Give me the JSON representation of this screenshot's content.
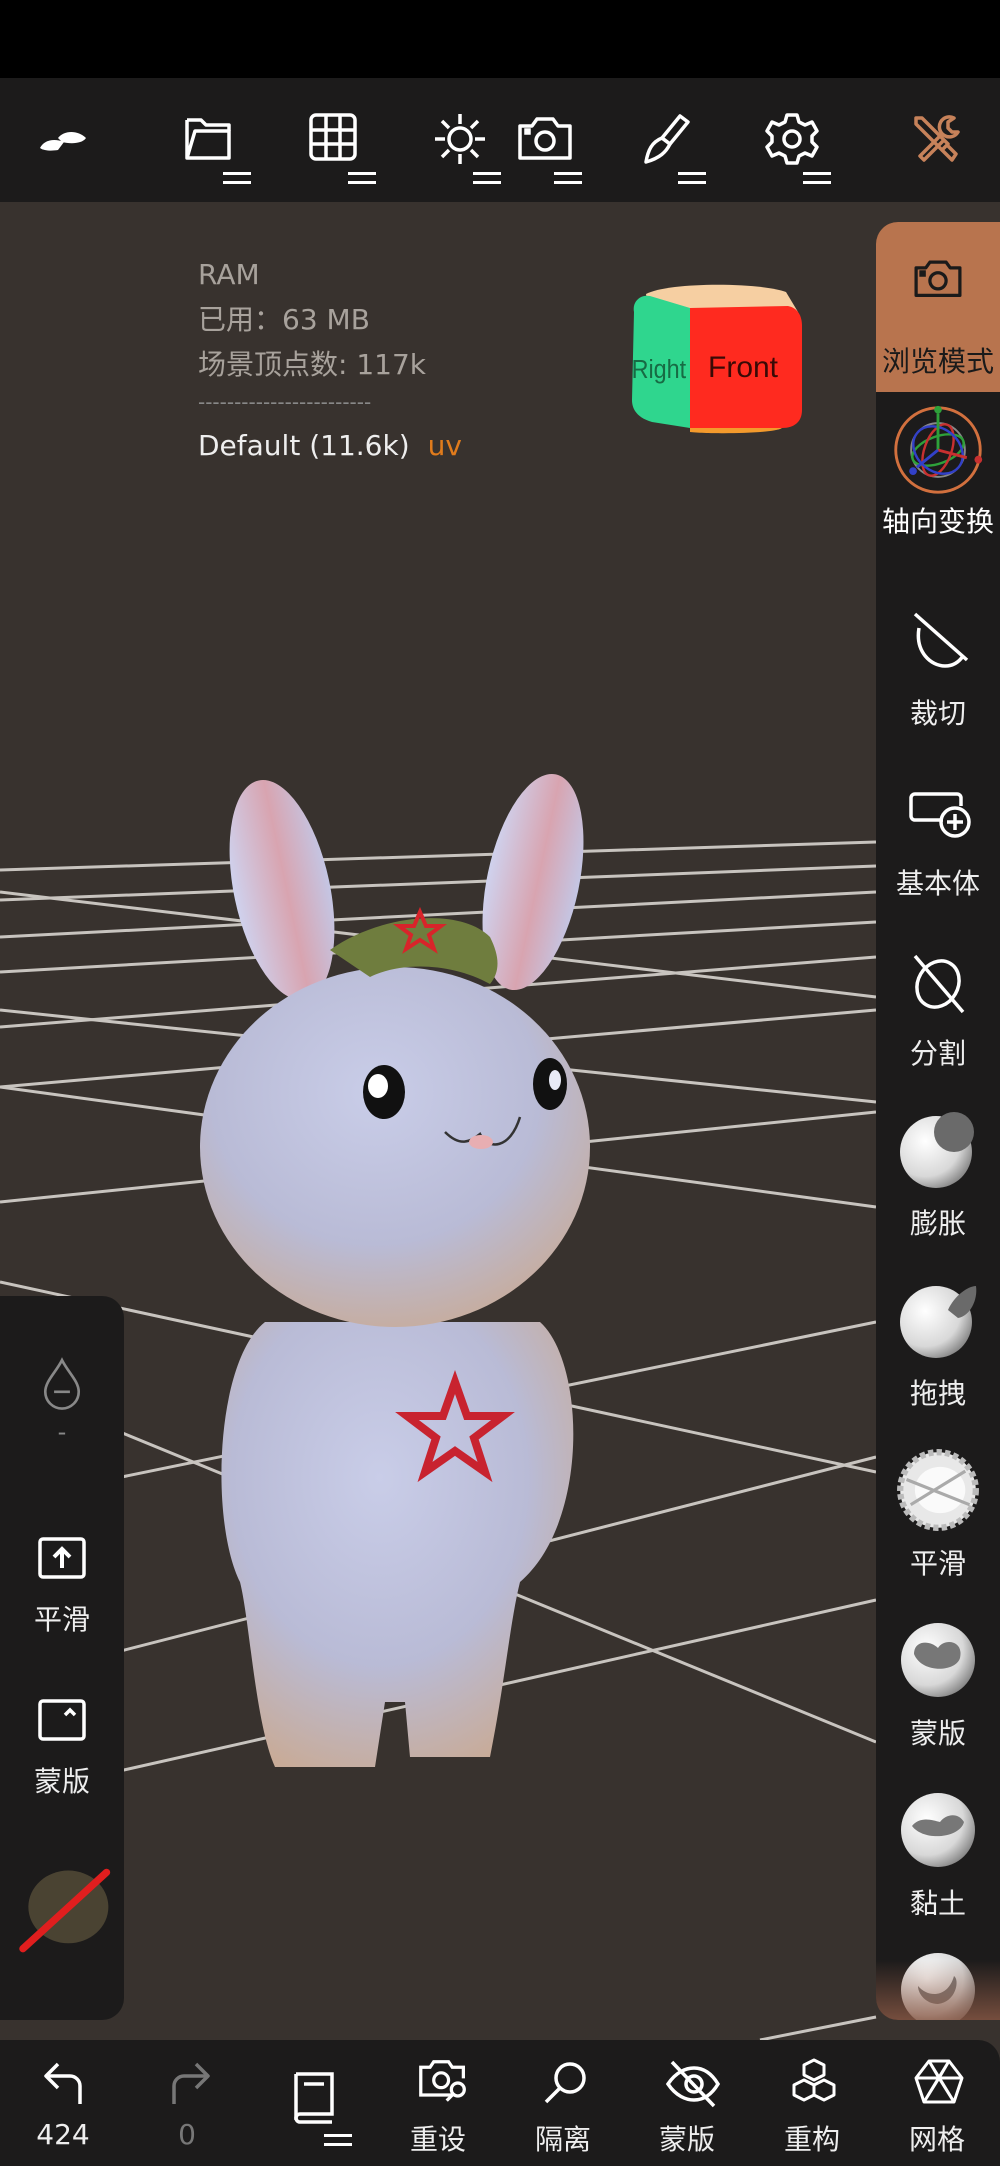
{
  "topbar": {
    "items": [
      {
        "name": "logo",
        "icon": "clay-logo-icon",
        "has_menu": false
      },
      {
        "name": "files",
        "icon": "folder-icon",
        "has_menu": true
      },
      {
        "name": "scene",
        "icon": "grid-icon",
        "has_menu": true
      },
      {
        "name": "lighting",
        "icon": "sun-icon",
        "has_menu": true
      },
      {
        "name": "camera",
        "icon": "camera-icon",
        "has_menu": true
      },
      {
        "name": "material",
        "icon": "paintbrush-icon",
        "has_menu": true
      },
      {
        "name": "settings",
        "icon": "gear-icon",
        "has_menu": true
      },
      {
        "name": "tools",
        "icon": "tools-icon",
        "has_menu": false,
        "color": "#c7825a"
      }
    ]
  },
  "info": {
    "ram_label": "RAM",
    "used_label": "已用：",
    "used_value": "63 MB",
    "vertices_label": "场景顶点数:",
    "vertices_value": "117k",
    "separator": "------------------------",
    "mesh_name": "Default (11.6k)",
    "mesh_tag": "uv"
  },
  "view_cube": {
    "right_label": "Right",
    "front_label": "Front",
    "right_color": "#2fd68e",
    "front_color": "#ff2a1f",
    "top_color": "#f6cfa2"
  },
  "right_panel": {
    "items": [
      {
        "label": "浏览模式",
        "icon": "camera-icon",
        "active": true
      },
      {
        "label": "轴向变换",
        "icon": "gizmo-icon",
        "active": false
      },
      {
        "label": "裁切",
        "icon": "trim-icon",
        "active": false
      },
      {
        "label": "基本体",
        "icon": "add-primitive-icon",
        "active": false
      },
      {
        "label": "分割",
        "icon": "split-icon",
        "active": false
      },
      {
        "label": "膨胀",
        "icon": "inflate-brush-icon",
        "active": false
      },
      {
        "label": "拖拽",
        "icon": "drag-brush-icon",
        "active": false
      },
      {
        "label": "平滑",
        "icon": "smooth-brush-icon",
        "active": false
      },
      {
        "label": "蒙版",
        "icon": "mask-brush-icon",
        "active": false
      },
      {
        "label": "黏土",
        "icon": "clay-brush-icon",
        "active": false
      },
      {
        "label": "",
        "icon": "crease-brush-icon",
        "active": false
      }
    ],
    "active_color": "#b8744e"
  },
  "left_panel": {
    "intensity_icon": "drop-minus-icon",
    "intensity_value": "-",
    "smooth_label": "平滑",
    "smooth_icon": "shift-key-icon",
    "mask_label": "蒙版",
    "mask_icon": "ctrl-key-icon",
    "material_icon": "no-material-icon"
  },
  "bottombar": {
    "undo_count": "424",
    "redo_count": "0",
    "items": [
      {
        "label": "重设",
        "icon": "camera-reset-icon"
      },
      {
        "label": "隔离",
        "icon": "search-icon"
      },
      {
        "label": "蒙版",
        "icon": "eye-off-icon"
      },
      {
        "label": "重构",
        "icon": "cubes-icon"
      },
      {
        "label": "网格",
        "icon": "mesh-icon"
      }
    ]
  }
}
